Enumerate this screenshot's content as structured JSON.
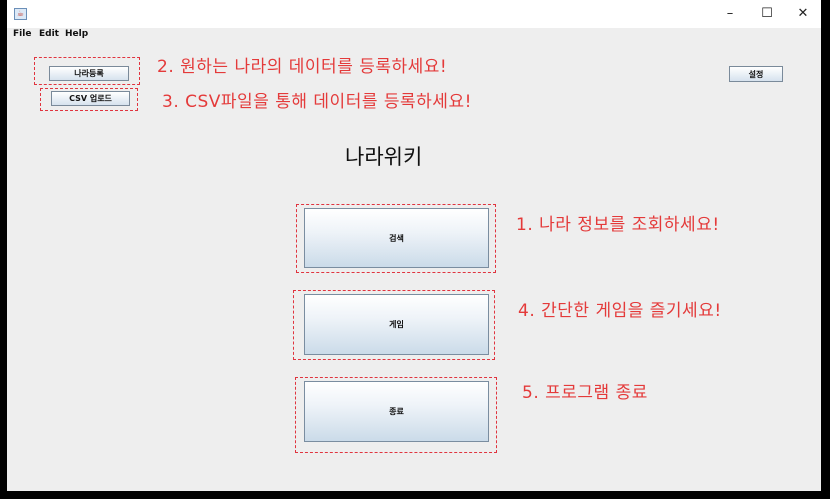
{
  "window": {
    "minimize_glyph": "–",
    "maximize_glyph": "☐",
    "close_glyph": "✕"
  },
  "menu": [
    "File",
    "Edit",
    "Help"
  ],
  "buttons": {
    "register_country": "나라등록",
    "csv_upload": "CSV 업로드",
    "settings": "설정",
    "search": "검색",
    "game": "게임",
    "exit": "종료"
  },
  "app_title": "나라위키",
  "annotations": {
    "note1": "1. 나라 정보를 조회하세요!",
    "note2": "2. 원하는 나라의 데이터를 등록하세요!",
    "note3": "3. CSV파일을 통해 데이터를 등록하세요!",
    "note4": "4. 간단한 게임을 즐기세요!",
    "note5": "5. 프로그램 종료"
  },
  "colors": {
    "annotation": "#e43a3a",
    "window_bg": "#eeeeee",
    "frame": "#000000"
  }
}
